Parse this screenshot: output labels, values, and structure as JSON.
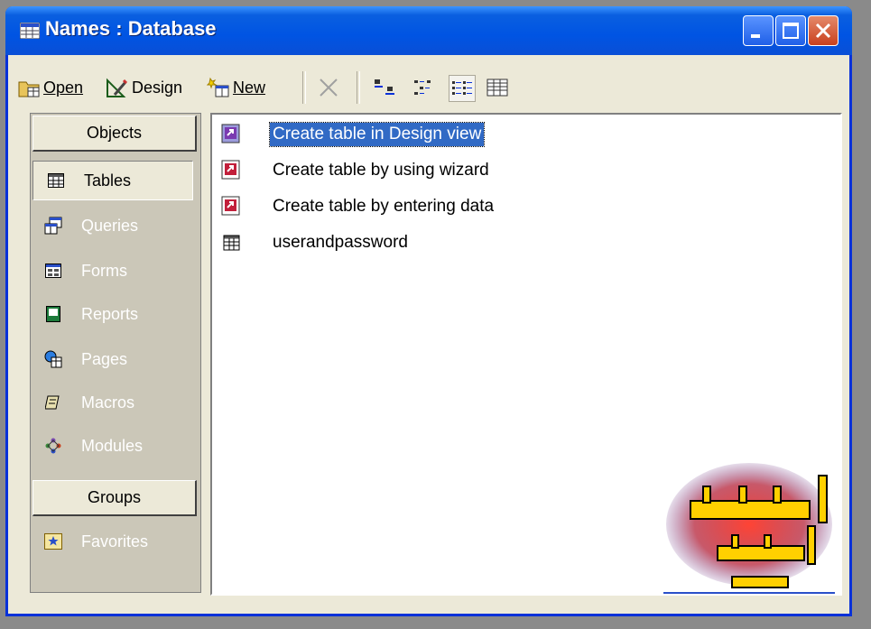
{
  "window": {
    "title": "Names : Database"
  },
  "toolbar": {
    "open_label": "Open",
    "design_label": "Design",
    "new_label": "New"
  },
  "objects_panel": {
    "objects_header": "Objects",
    "items": [
      {
        "label": "Tables",
        "icon": "table-icon",
        "selected": true
      },
      {
        "label": "Queries",
        "icon": "query-icon"
      },
      {
        "label": "Forms",
        "icon": "form-icon"
      },
      {
        "label": "Reports",
        "icon": "report-icon"
      },
      {
        "label": "Pages",
        "icon": "page-icon"
      },
      {
        "label": "Macros",
        "icon": "macro-icon"
      },
      {
        "label": "Modules",
        "icon": "module-icon"
      }
    ],
    "groups_header": "Groups",
    "groups": [
      {
        "label": "Favorites",
        "icon": "favorites-icon"
      }
    ]
  },
  "list": {
    "items": [
      {
        "label": "Create table in Design view",
        "icon": "shortcut-icon",
        "selected": true
      },
      {
        "label": "Create table by using wizard",
        "icon": "shortcut-icon"
      },
      {
        "label": "Create table by entering data",
        "icon": "shortcut-icon"
      },
      {
        "label": "userandpassword",
        "icon": "table-icon"
      }
    ]
  },
  "colors": {
    "title_bar": "#0054e3",
    "selection": "#316ac5",
    "panel": "#cbc7b8",
    "face": "#ece9d8"
  }
}
